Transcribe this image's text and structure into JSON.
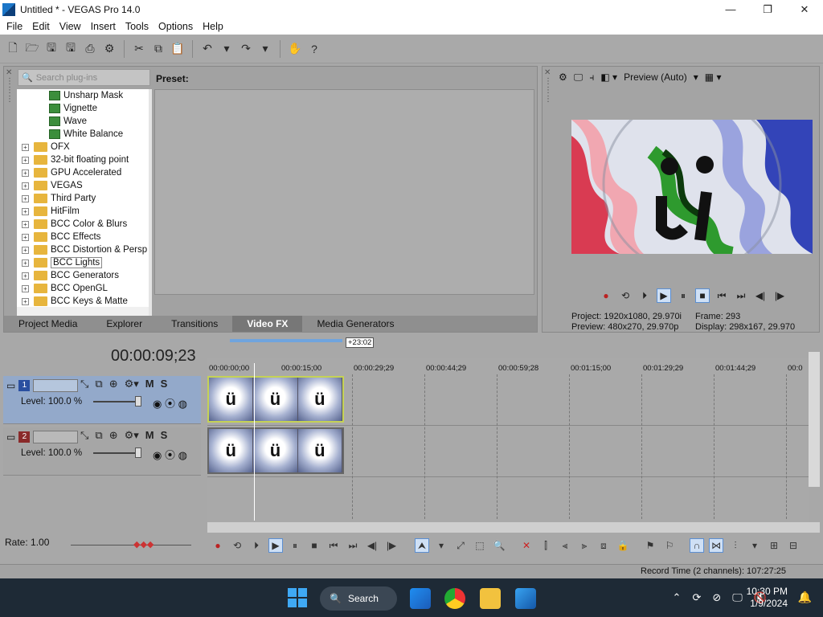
{
  "window": {
    "title": "Untitled * - VEGAS Pro 14.0",
    "min": "—",
    "max": "❐",
    "close": "✕"
  },
  "menu": [
    "File",
    "Edit",
    "View",
    "Insert",
    "Tools",
    "Options",
    "Help"
  ],
  "plugins": {
    "search_placeholder": "Search plug-ins",
    "preset_label": "Preset:",
    "tree": [
      {
        "label": "Unsharp Mask",
        "type": "fx"
      },
      {
        "label": "Vignette",
        "type": "fx"
      },
      {
        "label": "Wave",
        "type": "fx"
      },
      {
        "label": "White Balance",
        "type": "fx"
      },
      {
        "label": "OFX",
        "type": "folder"
      },
      {
        "label": "32-bit floating point",
        "type": "folder"
      },
      {
        "label": "GPU Accelerated",
        "type": "folder"
      },
      {
        "label": "VEGAS",
        "type": "folder"
      },
      {
        "label": "Third Party",
        "type": "folder"
      },
      {
        "label": "HitFilm",
        "type": "folder"
      },
      {
        "label": "BCC Color & Blurs",
        "type": "folder"
      },
      {
        "label": "BCC Effects",
        "type": "folder"
      },
      {
        "label": "BCC Distortion & Persp",
        "type": "folder"
      },
      {
        "label": "BCC Lights",
        "type": "folder",
        "selected": true
      },
      {
        "label": "BCC Generators",
        "type": "folder"
      },
      {
        "label": "BCC OpenGL",
        "type": "folder"
      },
      {
        "label": "BCC Keys & Matte",
        "type": "folder"
      }
    ]
  },
  "tabs": [
    {
      "label": "Project Media"
    },
    {
      "label": "Explorer"
    },
    {
      "label": "Transitions"
    },
    {
      "label": "Video FX",
      "active": true
    },
    {
      "label": "Media Generators"
    }
  ],
  "preview": {
    "mode_label": "Preview (Auto)",
    "project_label": "Project:",
    "project_value": "1920x1080, 29.970i",
    "preview_label": "Preview:",
    "preview_value": "480x270, 29.970p",
    "frame_label": "Frame:",
    "frame_value": "293",
    "display_label": "Display:",
    "display_value": "298x167, 29.970"
  },
  "timeline": {
    "timecode": "00:00:09;23",
    "loop_marker": "+23:02",
    "ruler": [
      "00:00:00;00",
      "00:00:15;00",
      "00:00:29;29",
      "00:00:44;29",
      "00:00:59;28",
      "00:01:15;00",
      "00:01:29;29",
      "00:01:44;29",
      "00:0"
    ],
    "tracks": [
      {
        "number": "1",
        "level": "Level: 100.0 %",
        "mute": "M",
        "solo": "S"
      },
      {
        "number": "2",
        "level": "Level: 100.0 %",
        "mute": "M",
        "solo": "S"
      }
    ],
    "clip_glyph": "ü",
    "rate": "Rate: 1.00"
  },
  "status": {
    "record_time": "Record Time (2 channels): 107:27:25"
  },
  "taskbar": {
    "search_label": "Search",
    "time": "10:30 PM",
    "date": "1/9/2024"
  }
}
